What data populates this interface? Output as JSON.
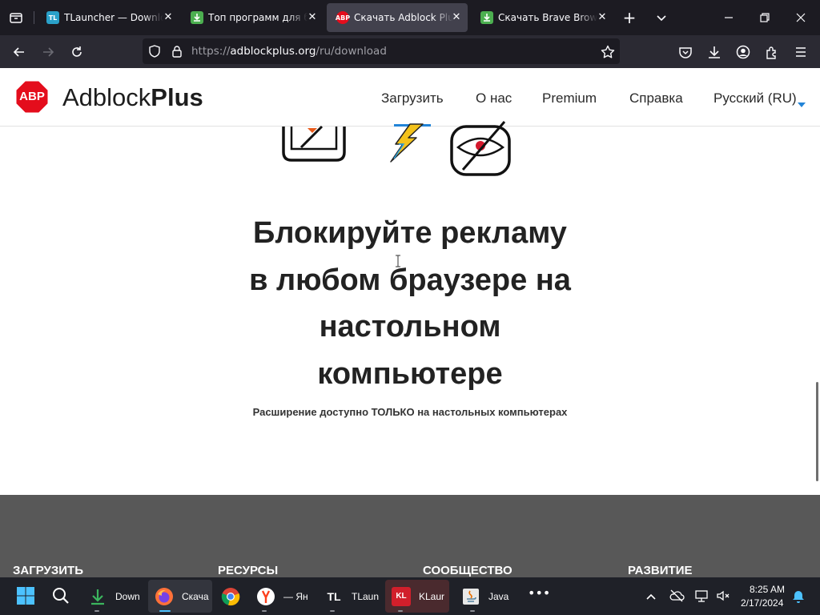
{
  "browser": {
    "tabs": [
      {
        "title": "TLauncher — Download",
        "favicon": "tlauncher-icon",
        "active": false
      },
      {
        "title": "Топ программ для бл",
        "favicon": "download-icon",
        "active": false
      },
      {
        "title": "Скачать Adblock Plus",
        "favicon": "abp-icon",
        "active": true
      },
      {
        "title": "Скачать Brave Browser",
        "favicon": "download-icon",
        "active": false
      }
    ],
    "url_prefix": "https://",
    "url_domain": "adblockplus.org",
    "url_path": "/ru/download"
  },
  "site": {
    "logo_text": "ABP",
    "brand_regular": "Adblock",
    "brand_bold": "Plus",
    "nav": [
      "Загрузить",
      "О нас",
      "Premium",
      "Справка",
      "Русский (RU)"
    ],
    "headline": [
      "Блокируйте рекламу",
      "в любом браузере на",
      "настольном",
      "компьютере"
    ],
    "subline": "Расширение доступно ТОЛЬКО на настольных компьютерах",
    "footer_headings": [
      "ЗАГРУЗИТЬ",
      "РЕСУРСЫ",
      "СООБЩЕСТВО",
      "РАЗВИТИЕ"
    ],
    "colors": {
      "brand_red": "#e40d1c",
      "accent_blue": "#2284d7"
    }
  },
  "taskbar": {
    "apps": [
      {
        "label": "Down",
        "icon": "download-arrow-icon"
      },
      {
        "label": "Скача",
        "icon": "firefox-icon"
      },
      {
        "label": "",
        "icon": "chrome-icon"
      },
      {
        "label": "— Ян",
        "icon": "yandex-icon"
      },
      {
        "label": "TLaun",
        "icon": "tlauncher-icon"
      },
      {
        "label": "KLaur",
        "icon": "klauncher-icon"
      },
      {
        "label": "Java",
        "icon": "java-icon"
      }
    ],
    "time": "8:25 AM",
    "date": "2/17/2024"
  }
}
